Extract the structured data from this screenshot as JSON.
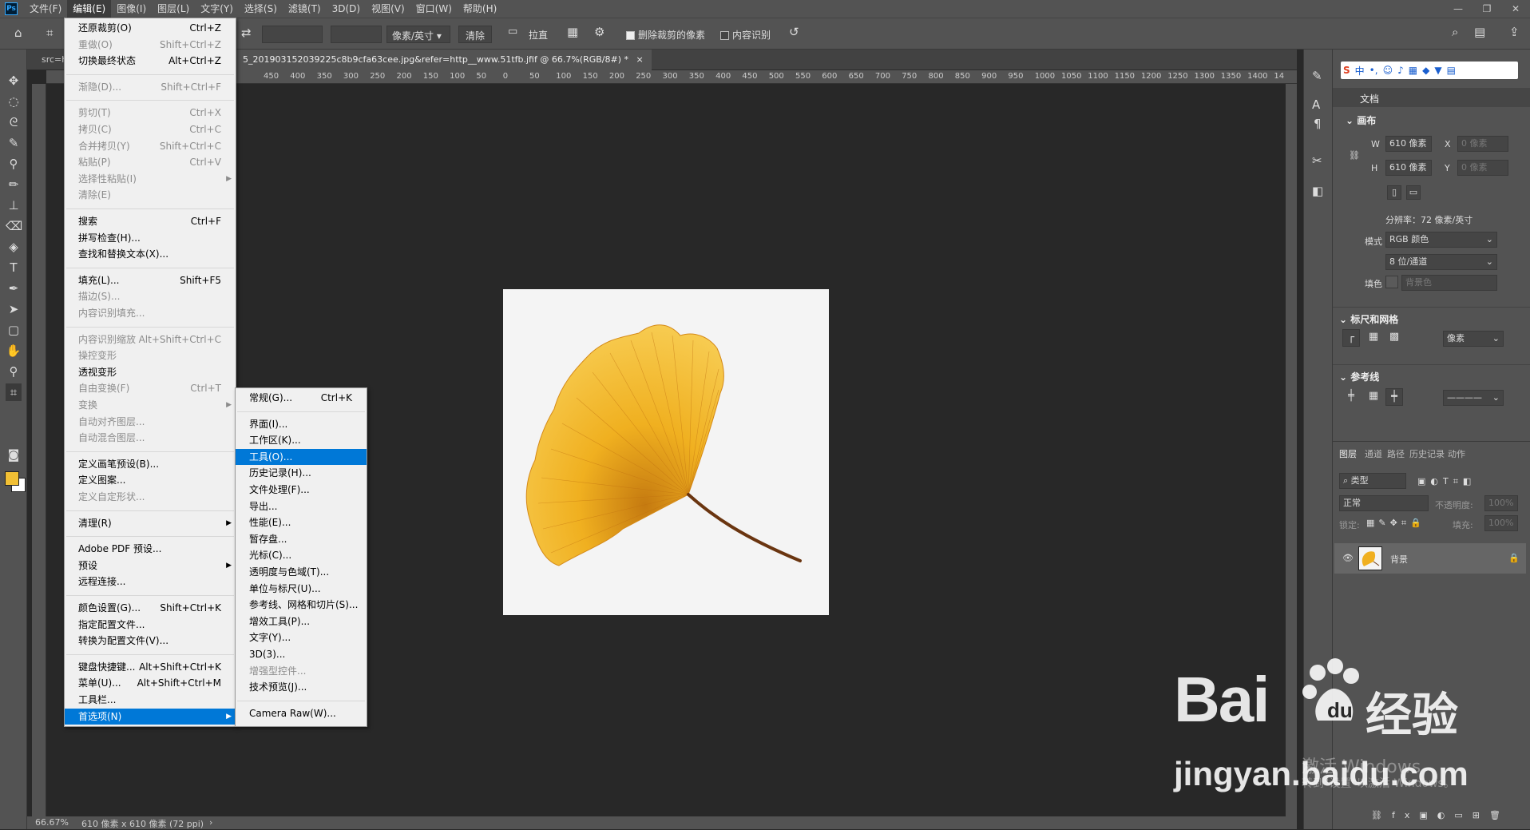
{
  "menubar": {
    "items": [
      "文件(F)",
      "编辑(E)",
      "图像(I)",
      "图层(L)",
      "文字(Y)",
      "选择(S)",
      "滤镜(T)",
      "3D(D)",
      "视图(V)",
      "窗口(W)",
      "帮助(H)"
    ],
    "open_item": "编辑(E)"
  },
  "options": {
    "units_dropdown": "像素/英寸",
    "clear_label": "清除",
    "straighten_label": "拉直",
    "delete_cropped_label": "删除裁剪的像素",
    "content_aware_label": "内容识别"
  },
  "document": {
    "tab_prefix": "src=h",
    "tab_title": "5_201903152039225c8b9cfa63cee.jpg&refer=http__www.51tfb.jfif @ 66.7%(RGB/8#) *",
    "ruler_ticks": [
      "450",
      "400",
      "350",
      "300",
      "250",
      "200",
      "150",
      "100",
      "50",
      "0",
      "50",
      "100",
      "150",
      "200",
      "250",
      "300",
      "350",
      "400",
      "450",
      "500",
      "550",
      "600",
      "650",
      "700",
      "750",
      "800",
      "850",
      "900",
      "950",
      "1000",
      "1050",
      "1100",
      "1150",
      "1200",
      "1250",
      "1300",
      "1350",
      "1400",
      "14"
    ]
  },
  "status": {
    "zoom": "66.67%",
    "doc_info": "610 像素 x 610 像素 (72 ppi)"
  },
  "edit_menu": [
    {
      "label": "还原裁剪(O)",
      "shortcut": "Ctrl+Z",
      "disabled": false
    },
    {
      "label": "重做(O)",
      "shortcut": "Shift+Ctrl+Z",
      "disabled": true
    },
    {
      "label": "切换最终状态",
      "shortcut": "Alt+Ctrl+Z",
      "disabled": false
    },
    {
      "sep": true
    },
    {
      "label": "渐隐(D)...",
      "shortcut": "Shift+Ctrl+F",
      "disabled": true
    },
    {
      "sep": true
    },
    {
      "label": "剪切(T)",
      "shortcut": "Ctrl+X",
      "disabled": true
    },
    {
      "label": "拷贝(C)",
      "shortcut": "Ctrl+C",
      "disabled": true
    },
    {
      "label": "合并拷贝(Y)",
      "shortcut": "Shift+Ctrl+C",
      "disabled": true
    },
    {
      "label": "粘贴(P)",
      "shortcut": "Ctrl+V",
      "disabled": true
    },
    {
      "label": "选择性粘贴(I)",
      "shortcut": "",
      "disabled": true,
      "submenu": true
    },
    {
      "label": "清除(E)",
      "shortcut": "",
      "disabled": true
    },
    {
      "sep": true
    },
    {
      "label": "搜索",
      "shortcut": "Ctrl+F",
      "disabled": false
    },
    {
      "label": "拼写检查(H)...",
      "shortcut": "",
      "disabled": false
    },
    {
      "label": "查找和替换文本(X)...",
      "shortcut": "",
      "disabled": false
    },
    {
      "sep": true
    },
    {
      "label": "填充(L)...",
      "shortcut": "Shift+F5",
      "disabled": false
    },
    {
      "label": "描边(S)...",
      "shortcut": "",
      "disabled": true
    },
    {
      "label": "内容识别填充...",
      "shortcut": "",
      "disabled": true
    },
    {
      "sep": true
    },
    {
      "label": "内容识别缩放",
      "shortcut": "Alt+Shift+Ctrl+C",
      "disabled": true
    },
    {
      "label": "操控变形",
      "shortcut": "",
      "disabled": true
    },
    {
      "label": "透视变形",
      "shortcut": "",
      "disabled": false
    },
    {
      "label": "自由变换(F)",
      "shortcut": "Ctrl+T",
      "disabled": true
    },
    {
      "label": "变换",
      "shortcut": "",
      "disabled": true,
      "submenu": true
    },
    {
      "label": "自动对齐图层...",
      "shortcut": "",
      "disabled": true
    },
    {
      "label": "自动混合图层...",
      "shortcut": "",
      "disabled": true
    },
    {
      "sep": true
    },
    {
      "label": "定义画笔预设(B)...",
      "shortcut": "",
      "disabled": false
    },
    {
      "label": "定义图案...",
      "shortcut": "",
      "disabled": false
    },
    {
      "label": "定义自定形状...",
      "shortcut": "",
      "disabled": true
    },
    {
      "sep": true
    },
    {
      "label": "清理(R)",
      "shortcut": "",
      "disabled": false,
      "submenu": true
    },
    {
      "sep": true
    },
    {
      "label": "Adobe PDF 预设...",
      "shortcut": "",
      "disabled": false
    },
    {
      "label": "预设",
      "shortcut": "",
      "disabled": false,
      "submenu": true
    },
    {
      "label": "远程连接...",
      "shortcut": "",
      "disabled": false
    },
    {
      "sep": true
    },
    {
      "label": "颜色设置(G)...",
      "shortcut": "Shift+Ctrl+K",
      "disabled": false
    },
    {
      "label": "指定配置文件...",
      "shortcut": "",
      "disabled": false
    },
    {
      "label": "转换为配置文件(V)...",
      "shortcut": "",
      "disabled": false
    },
    {
      "sep": true
    },
    {
      "label": "键盘快捷键...",
      "shortcut": "Alt+Shift+Ctrl+K",
      "disabled": false
    },
    {
      "label": "菜单(U)...",
      "shortcut": "Alt+Shift+Ctrl+M",
      "disabled": false
    },
    {
      "label": "工具栏...",
      "shortcut": "",
      "disabled": false
    },
    {
      "label": "首选项(N)",
      "shortcut": "",
      "disabled": false,
      "submenu": true,
      "highlight": true
    }
  ],
  "prefs_submenu": [
    {
      "label": "常规(G)...",
      "shortcut": "Ctrl+K",
      "disabled": false
    },
    {
      "sep": true
    },
    {
      "label": "界面(I)...",
      "shortcut": "",
      "disabled": false
    },
    {
      "label": "工作区(K)...",
      "shortcut": "",
      "disabled": false
    },
    {
      "label": "工具(O)...",
      "shortcut": "",
      "disabled": false,
      "highlight": true
    },
    {
      "label": "历史记录(H)...",
      "shortcut": "",
      "disabled": false
    },
    {
      "label": "文件处理(F)...",
      "shortcut": "",
      "disabled": false
    },
    {
      "label": "导出...",
      "shortcut": "",
      "disabled": false
    },
    {
      "label": "性能(E)...",
      "shortcut": "",
      "disabled": false
    },
    {
      "label": "暂存盘...",
      "shortcut": "",
      "disabled": false
    },
    {
      "label": "光标(C)...",
      "shortcut": "",
      "disabled": false
    },
    {
      "label": "透明度与色域(T)...",
      "shortcut": "",
      "disabled": false
    },
    {
      "label": "单位与标尺(U)...",
      "shortcut": "",
      "disabled": false
    },
    {
      "label": "参考线、网格和切片(S)...",
      "shortcut": "",
      "disabled": false
    },
    {
      "label": "增效工具(P)...",
      "shortcut": "",
      "disabled": false
    },
    {
      "label": "文字(Y)...",
      "shortcut": "",
      "disabled": false
    },
    {
      "label": "3D(3)...",
      "shortcut": "",
      "disabled": false
    },
    {
      "label": "增强型控件...",
      "shortcut": "",
      "disabled": true
    },
    {
      "label": "技术预览(J)...",
      "shortcut": "",
      "disabled": false
    },
    {
      "sep": true
    },
    {
      "label": "Camera Raw(W)...",
      "shortcut": "",
      "disabled": false
    }
  ],
  "properties": {
    "doc_label": "文档",
    "canvas_title": "画布",
    "w_label": "W",
    "w_value": "610 像素",
    "h_label": "H",
    "h_value": "610 像素",
    "x_label": "X",
    "x_value": "0 像素",
    "y_label": "Y",
    "y_value": "0 像素",
    "resolution": "分辨率：72 像素/英寸",
    "mode_label": "模式",
    "mode_value": "RGB 颜色",
    "depth_value": "8 位/通道",
    "fill_label": "填色",
    "fill_value": "背景色",
    "rulers_title": "标尺和网格",
    "rulers_unit": "像素",
    "guides_title": "参考线"
  },
  "layers": {
    "tabs": [
      "图层",
      "通道",
      "路径",
      "历史记录",
      "动作"
    ],
    "kind_placeholder": "类型",
    "blend_mode": "正常",
    "opacity_label": "不透明度:",
    "opacity_value": "100%",
    "lock_label": "锁定:",
    "fill_label": "填充:",
    "fill_value": "100%",
    "layer_name": "背景"
  },
  "watermark": {
    "brand": "Bai",
    "brand_cn": "经验",
    "url": "jingyan.baidu.com",
    "activate_line1": "激活 Windows",
    "activate_line2": "转到\"设置\"以激活 Windows。"
  },
  "colors": {
    "foreground": "#f2c034",
    "background": "#ffffff",
    "menu_highlight": "#0078d7",
    "leaf_gold": "#f0b020"
  }
}
